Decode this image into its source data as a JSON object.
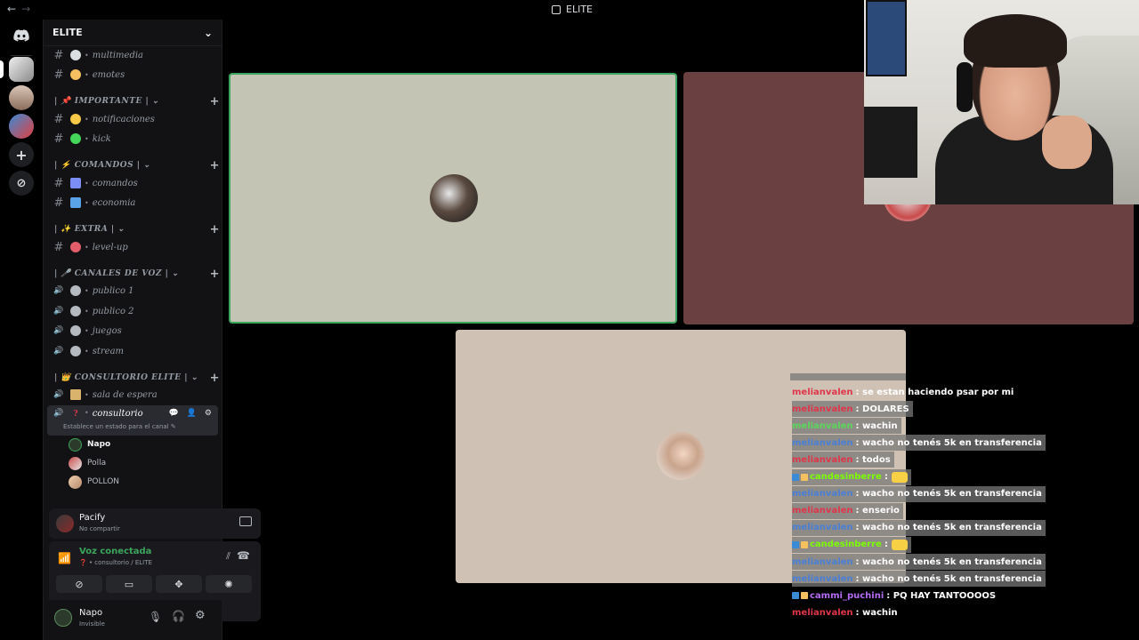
{
  "window": {
    "title": "ELITE",
    "nav_back": "←",
    "nav_fwd": "→"
  },
  "guild": {
    "name": "ELITE",
    "chevron": "⌄"
  },
  "categories": [
    {
      "label": "| 📌 IMPORTANTE | ⌄",
      "plus": "+"
    },
    {
      "label": "| ⚡ COMANDOS | ⌄",
      "plus": "+"
    },
    {
      "label": "| ✨ EXTRA | ⌄",
      "plus": "+"
    },
    {
      "label": "| 🎤 CANALES DE VOZ | ⌄",
      "plus": "+"
    },
    {
      "label": "| 👑 CONSULTORIO ELITE | ⌄",
      "plus": "+"
    }
  ],
  "channels": [
    {
      "icon": "#",
      "emoji_color": "#dbdee1",
      "label": "multimedia"
    },
    {
      "icon": "#",
      "emoji_color": "#f5c05f",
      "label": "emotes"
    },
    {
      "icon": "#",
      "emoji_color": "#f7c948",
      "label": "notificaciones"
    },
    {
      "icon": "#",
      "emoji_color": "#43d65b",
      "label": "kick"
    },
    {
      "icon": "#",
      "emoji_color": "#7b8ef5",
      "label": "comandos"
    },
    {
      "icon": "#",
      "emoji_color": "#5ba3e8",
      "label": "economia"
    },
    {
      "icon": "#",
      "emoji_color": "#e35d6a",
      "label": "level-up"
    },
    {
      "icon": "🔊",
      "emoji_color": "#b5bac1",
      "label": "publico 1"
    },
    {
      "icon": "🔊",
      "emoji_color": "#b5bac1",
      "label": "publico 2"
    },
    {
      "icon": "🔊",
      "emoji_color": "#b5bac1",
      "label": "juegos"
    },
    {
      "icon": "🔊",
      "emoji_color": "#b5bac1",
      "label": "stream"
    },
    {
      "icon": "🔊",
      "emoji_color": "#d9b26b",
      "label": "sala de espera"
    }
  ],
  "active_channel": {
    "label": "consultorio",
    "status": "Establece un estado para el canal ✎",
    "tools": "💬 👤 ⚙"
  },
  "voice_users": [
    "Napo",
    "Polla",
    "POLLON"
  ],
  "stream_panel": {
    "name": "Pacify",
    "sub": "No compartir"
  },
  "voice_panel": {
    "title": "Voz conectada",
    "sub": "❓ • consultorio / ELITE"
  },
  "user_panel": {
    "name": "Napo",
    "status": "Invisible"
  },
  "chat": [
    {
      "user": "melianvalen",
      "color": "#e0364a",
      "text": ": se estan haciendo psar por mi",
      "bg": false
    },
    {
      "user": "melianvalen",
      "color": "#e0364a",
      "text": ": DOLARES",
      "bg": true
    },
    {
      "user": "melianvalen",
      "color": "#5cd65c",
      "text": ": wachin",
      "bg": true
    },
    {
      "user": "melianvalen",
      "color": "#4a7fd6",
      "text": ": wacho no tenés 5k en transferencia",
      "bg": true
    },
    {
      "user": "melianvalen",
      "color": "#e0364a",
      "text": ": todos",
      "bg": true
    },
    {
      "user": "candesinberre",
      "color": "#7cfc00",
      "text": ":",
      "bg": true
    },
    {
      "user": "melianvalen",
      "color": "#4a7fd6",
      "text": ": wacho no tenés 5k en transferencia",
      "bg": true
    },
    {
      "user": "melianvalen",
      "color": "#e0364a",
      "text": ": enserio",
      "bg": true
    },
    {
      "user": "melianvalen",
      "color": "#4a7fd6",
      "text": ": wacho no tenés 5k en transferencia",
      "bg": true
    },
    {
      "user": "candesinberre",
      "color": "#7cfc00",
      "text": ":",
      "bg": true
    },
    {
      "user": "melianvalen",
      "color": "#4a7fd6",
      "text": ": wacho no tenés 5k en transferencia",
      "bg": true
    },
    {
      "user": "melianvalen",
      "color": "#4a7fd6",
      "text": ": wacho no tenés 5k en transferencia",
      "bg": true
    },
    {
      "user": "cammi_puchini",
      "color": "#b56cf5",
      "text": ": PQ HAY TANTOOOOS",
      "bg": false
    },
    {
      "user": "melianvalen",
      "color": "#e0364a",
      "text": ": wachin",
      "bg": false
    }
  ],
  "colors": {
    "tile1": "#c4c4b4",
    "tile2": "#6b4040",
    "tile3": "#cfc1b3",
    "speaking": "#3ba55c"
  }
}
